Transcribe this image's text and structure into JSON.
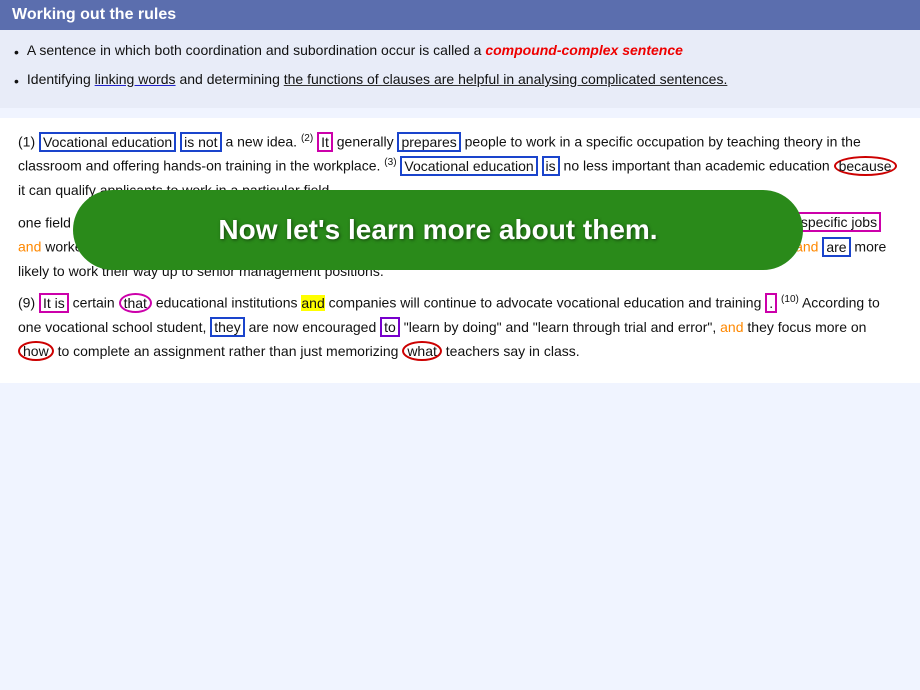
{
  "header": {
    "title": "Working out the rules"
  },
  "rules": [
    {
      "text_parts": [
        {
          "text": "A sentence in which both coordination and subordination occur is called a ",
          "style": "normal"
        },
        {
          "text": "compound-complex sentence",
          "style": "red-bold-italic"
        }
      ]
    },
    {
      "text_parts": [
        {
          "text": "Identifying ",
          "style": "normal"
        },
        {
          "text": "linking words",
          "style": "underline-blue"
        },
        {
          "text": " and determining ",
          "style": "normal"
        },
        {
          "text": "the functions of clauses are helpful in analysing complicated sentences.",
          "style": "underline-dark"
        }
      ]
    }
  ],
  "body": {
    "sentences": [
      {
        "number": "(1)",
        "html_desc": "Vocational education is not a new idea..."
      }
    ],
    "oval_text": "Now let's learn more about them."
  },
  "paragraphs": {
    "p1": "(1) Vocational education is not a new idea. (2) It generally prepares people to work in a specific occupation by teaching theory in the classroom and offering hands-on training in the workplace. (3) Vocational education is no less important than academic education because it can qualify applicants to work in a particular field.",
    "p2": "one field that allows for such career development. (7) Most motor repair companies have their own training programmes for specific jobs and workers can start off in training positions. (8) People who have been trained in schools often learn and adapt faster and are more likely to work their way up to senior management positions.",
    "p3": "(9) It is certain that educational institutions and companies will continue to advocate vocational education and training. (10) According to one vocational school student, they are now encouraged to \"learn by doing\" and \"learn through trial and error\", and they focus more on how to complete an assignment rather than just memorizing what teachers say in class."
  }
}
